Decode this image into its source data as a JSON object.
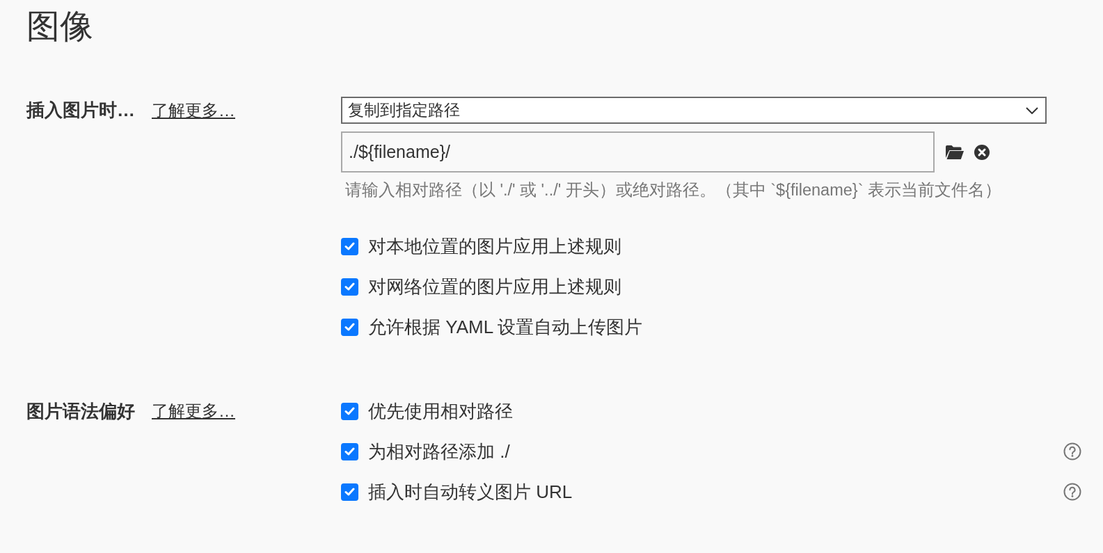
{
  "title": "图像",
  "sections": [
    {
      "label": "插入图片时…",
      "link": "了解更多…",
      "controls": [
        {
          "kind": "select",
          "value": "复制到指定路径"
        },
        {
          "kind": "path",
          "value": "./${filename}/",
          "hint": "请输入相对路径（以 './' 或 '../' 开头）或绝对路径。（其中 `${filename}` 表示当前文件名）"
        },
        {
          "kind": "checkbox",
          "label": "对本地位置的图片应用上述规则",
          "checked": true,
          "help": false
        },
        {
          "kind": "checkbox",
          "label": "对网络位置的图片应用上述规则",
          "checked": true,
          "help": false
        },
        {
          "kind": "checkbox",
          "label": "允许根据 YAML 设置自动上传图片",
          "checked": true,
          "help": false
        }
      ]
    },
    {
      "label": "图片语法偏好",
      "link": "了解更多…",
      "controls": [
        {
          "kind": "checkbox",
          "label": "优先使用相对路径",
          "checked": true,
          "help": false
        },
        {
          "kind": "checkbox",
          "label": "为相对路径添加 ./",
          "checked": true,
          "help": true
        },
        {
          "kind": "checkbox",
          "label": "插入时自动转义图片 URL",
          "checked": true,
          "help": true
        }
      ]
    }
  ]
}
